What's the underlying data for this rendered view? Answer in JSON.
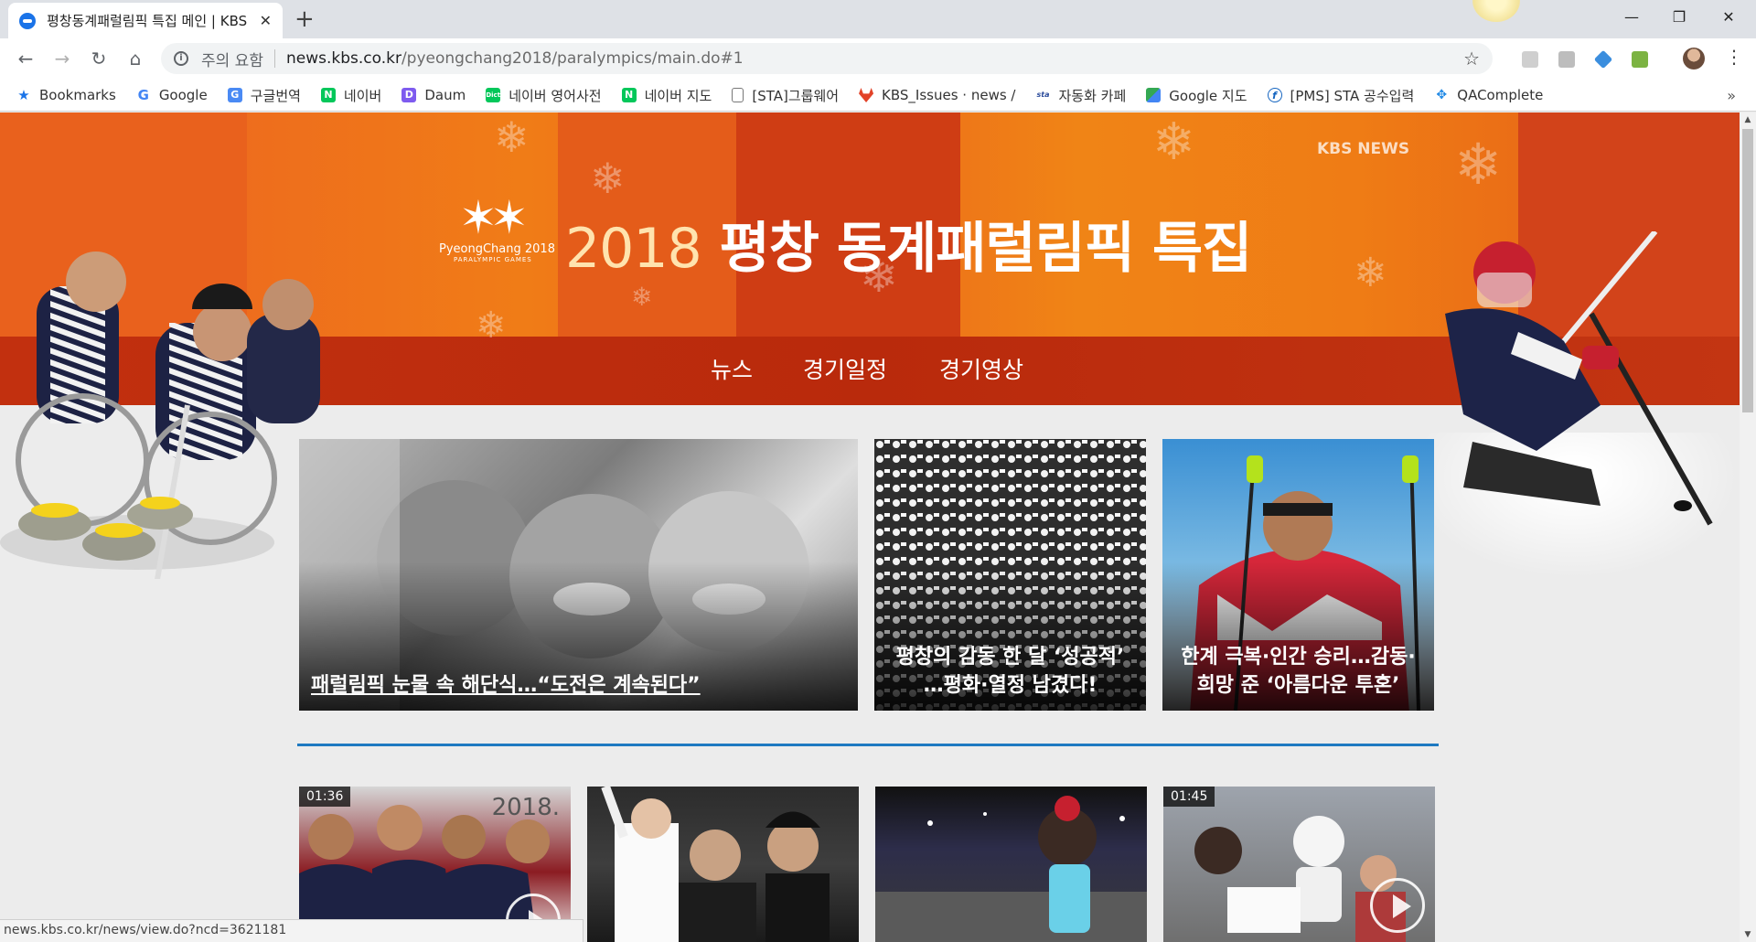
{
  "browser": {
    "tab_title": "평창동계패럴림픽 특집 메인 | KBS",
    "url_security": "주의 요함",
    "url_host": "news.kbs.co.kr",
    "url_path": "/pyeongchang2018/paralympics/main.do#1",
    "status_url": "news.kbs.co.kr/news/view.do?ncd=3621181"
  },
  "bookmarks": [
    {
      "label": "Bookmarks",
      "icon": "star-icon",
      "color": "#1a73e8"
    },
    {
      "label": "Google",
      "icon": "google-icon",
      "color": "#4285f4"
    },
    {
      "label": "구글번역",
      "icon": "translate-icon",
      "color": "#4a8af4"
    },
    {
      "label": "네이버",
      "icon": "naver-icon",
      "color": "#03c75a"
    },
    {
      "label": "Daum",
      "icon": "daum-icon",
      "color": "#7e5bef"
    },
    {
      "label": "네이버 영어사전",
      "icon": "dict-icon",
      "color": "#03c75a"
    },
    {
      "label": "네이버 지도",
      "icon": "naver-icon",
      "color": "#03c75a"
    },
    {
      "label": "[STA]그룹웨어",
      "icon": "page-icon",
      "color": "#9e9e9e"
    },
    {
      "label": "KBS_Issues · news / ",
      "icon": "gitlab-icon",
      "color": "#e24329"
    },
    {
      "label": "자동화 카페",
      "icon": "sta-icon",
      "color": "#2b4b9b"
    },
    {
      "label": "Google 지도",
      "icon": "maps-icon",
      "color": "#34a853"
    },
    {
      "label": "[PMS] STA 공수입력",
      "icon": "pms-icon",
      "color": "#1565c0"
    },
    {
      "label": "QAComplete",
      "icon": "qacomplete-icon",
      "color": "#1e88e5"
    }
  ],
  "banner": {
    "brand": "KBS NEWS",
    "logo_text": "PyeongChang 2018",
    "logo_sub": "PARALYMPIC GAMES",
    "title_year": "2018",
    "title_text": " 평창 동계패럴림픽 특집",
    "nav": [
      "뉴스",
      "경기일정",
      "경기영상"
    ]
  },
  "headlines": [
    {
      "caption": "패럴림픽 눈물 속 해단식…“도전은 계속된다”"
    },
    {
      "caption": "평창의 감동 한 달 ‘성공적’\n…평화·열정 남겼다!"
    },
    {
      "caption": "한계 극복·인간 승리…감동·\n희망 준 ‘아름다운 투혼’"
    }
  ],
  "videos": [
    {
      "duration": "01:36",
      "overlay": "2018."
    },
    {
      "duration": ""
    },
    {
      "duration": ""
    },
    {
      "duration": "01:45"
    }
  ],
  "colors": {
    "accent": "#1e79c1",
    "banner": "#ee6d1d",
    "strip": "#c2300f"
  }
}
